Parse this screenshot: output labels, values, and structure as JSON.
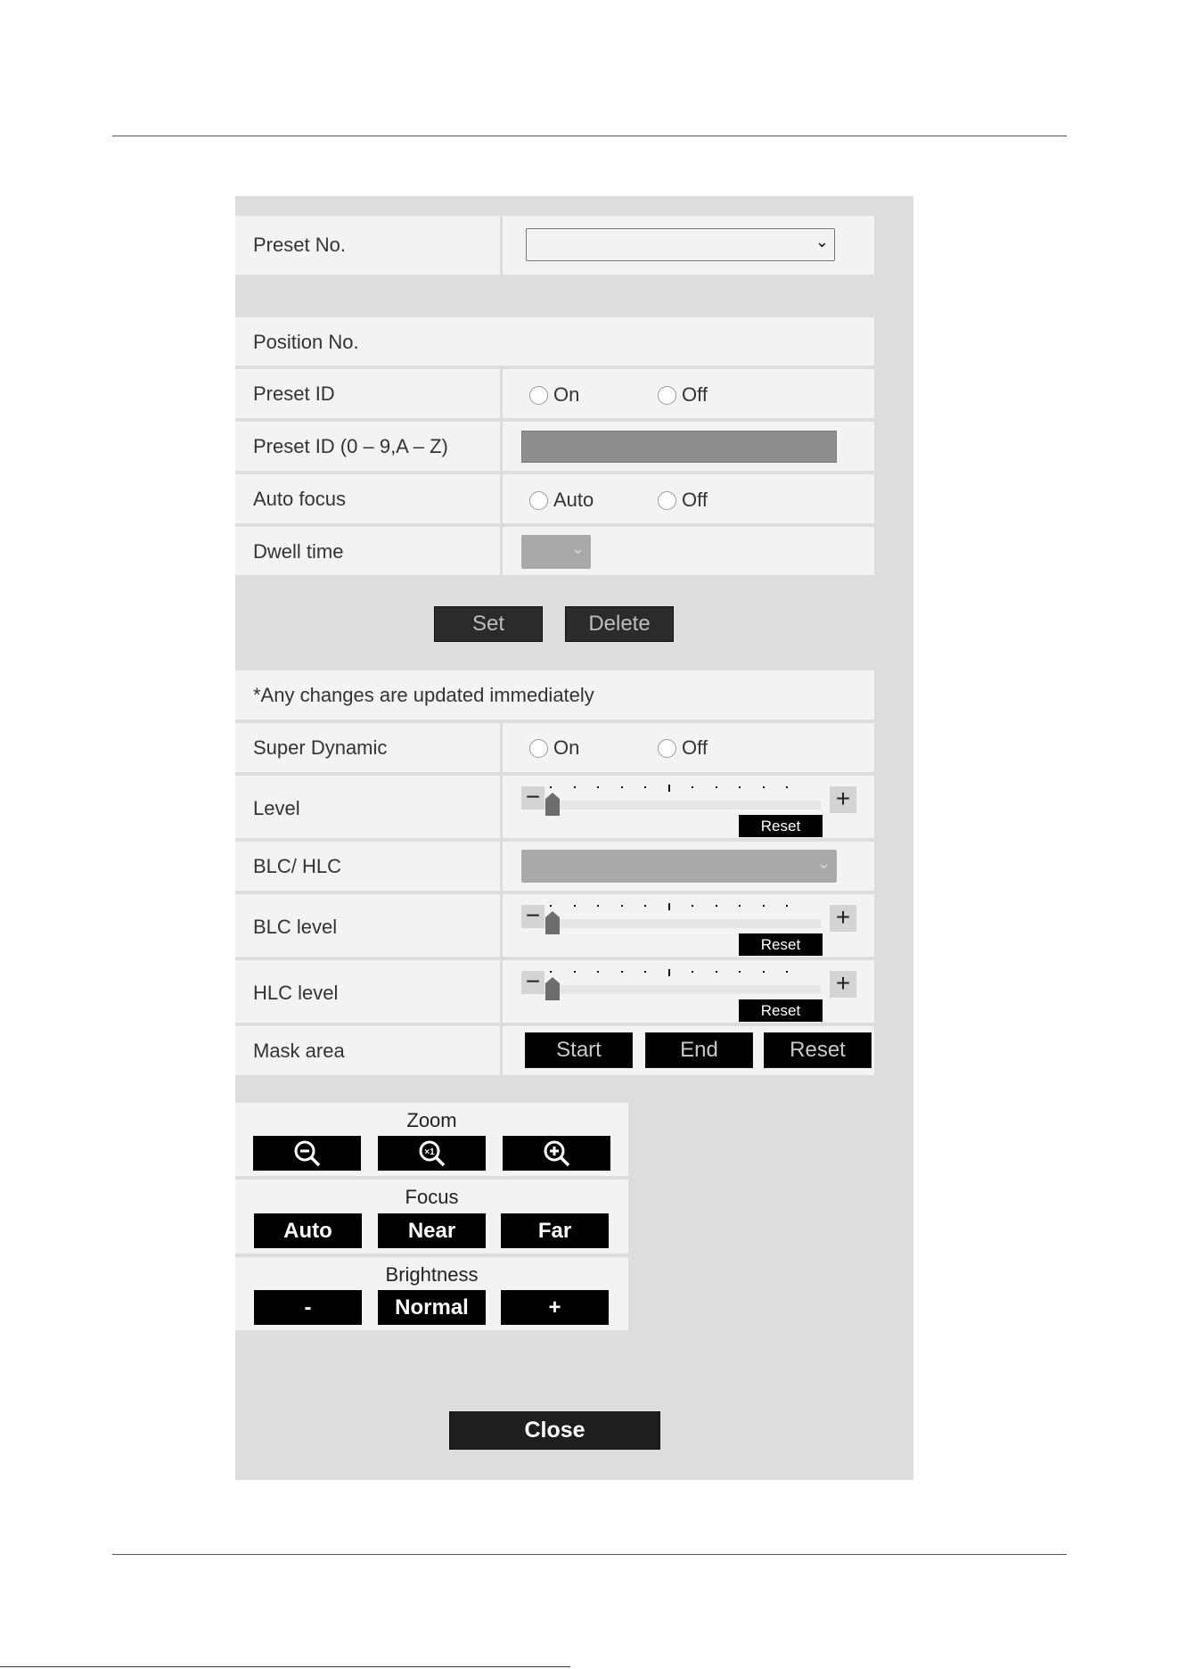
{
  "panel": {
    "preset_no": {
      "label": "Preset No.",
      "value": ""
    },
    "position_no": {
      "label": "Position No."
    },
    "preset_id": {
      "label": "Preset ID",
      "options": [
        "On",
        "Off"
      ]
    },
    "preset_id_text": {
      "label": "Preset ID (0 – 9,A – Z)",
      "value": ""
    },
    "auto_focus": {
      "label": "Auto focus",
      "options": [
        "Auto",
        "Off"
      ]
    },
    "dwell_time": {
      "label": "Dwell time",
      "value": ""
    },
    "buttons": {
      "set": "Set",
      "delete": "Delete"
    },
    "notice": "*Any changes are updated immediately",
    "super_dynamic": {
      "label": "Super Dynamic",
      "options": [
        "On",
        "Off"
      ]
    },
    "level": {
      "label": "Level",
      "reset": "Reset",
      "value_fraction": 0.0
    },
    "blc_hlc": {
      "label": "BLC/ HLC",
      "value": ""
    },
    "blc_level": {
      "label": "BLC level",
      "reset": "Reset",
      "value_fraction": 0.0
    },
    "hlc_level": {
      "label": "HLC level",
      "reset": "Reset",
      "value_fraction": 0.0
    },
    "mask_area": {
      "label": "Mask area",
      "start": "Start",
      "end": "End",
      "reset": "Reset"
    }
  },
  "controls": {
    "zoom": {
      "title": "Zoom",
      "buttons": [
        "zoom-out-icon",
        "zoom-x1-icon",
        "zoom-in-icon"
      ]
    },
    "focus": {
      "title": "Focus",
      "buttons": [
        "Auto",
        "Near",
        "Far"
      ]
    },
    "brightness": {
      "title": "Brightness",
      "buttons": [
        "-",
        "Normal",
        "+"
      ]
    }
  },
  "close": "Close",
  "colors": {
    "panel_bg": "#dddddd",
    "row_bg": "#f3f3f3",
    "button_bg": "#000000",
    "disabled_bg": "#a9a9a9"
  }
}
